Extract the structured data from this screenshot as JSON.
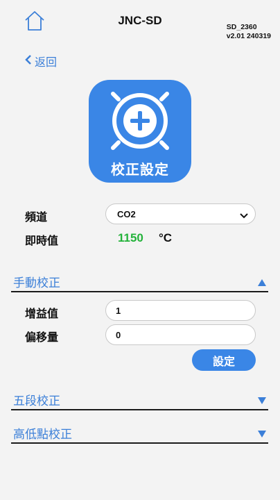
{
  "header": {
    "title": "JNC-SD",
    "device_id": "SD_2360",
    "version": "v2.01 240319"
  },
  "nav": {
    "back_label": "返回"
  },
  "hero": {
    "label": "校正設定",
    "icon": "crosshair-plus-icon"
  },
  "channel": {
    "label": "頻道",
    "selected": "CO2"
  },
  "realtime": {
    "label": "即時值",
    "value": "1150",
    "unit": "°C"
  },
  "sections": {
    "manual": {
      "title": "手動校正",
      "expanded": true,
      "gain_label": "增益值",
      "gain_value": "1",
      "offset_label": "偏移量",
      "offset_value": "0",
      "set_label": "設定"
    },
    "five_point": {
      "title": "五段校正",
      "expanded": false
    },
    "high_low": {
      "title": "高低點校正",
      "expanded": false
    }
  },
  "colors": {
    "accent": "#3a86e6",
    "value_green": "#23b23a"
  }
}
